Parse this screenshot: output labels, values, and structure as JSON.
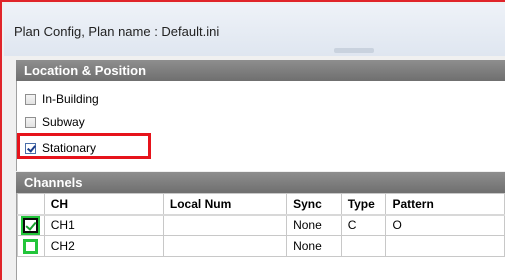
{
  "window": {
    "title": "Plan Config, Plan name : Default.ini"
  },
  "location": {
    "header": "Location & Position",
    "options": [
      {
        "label": "In-Building",
        "checked": false
      },
      {
        "label": "Subway",
        "checked": false
      },
      {
        "label": "Stationary",
        "checked": true
      }
    ]
  },
  "channels": {
    "header": "Channels",
    "columns": [
      "",
      "CH",
      "Local Num",
      "Sync",
      "Type",
      "Pattern"
    ],
    "rows": [
      {
        "checked": true,
        "ch": "CH1",
        "local_num": "",
        "sync": "None",
        "type": "C",
        "pattern": "O"
      },
      {
        "checked": false,
        "ch": "CH2",
        "local_num": "",
        "sync": "None",
        "type": "",
        "pattern": ""
      }
    ]
  },
  "colors": {
    "highlight": "#e6131b",
    "row_check": "#22c53a",
    "header_bg": "#7f7f7f"
  }
}
